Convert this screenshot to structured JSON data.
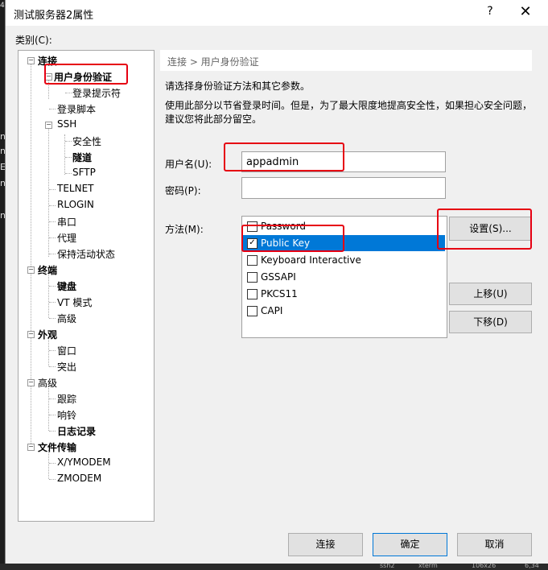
{
  "background_window": {
    "side_chars": [
      "n",
      "n",
      "E",
      "n",
      "n"
    ],
    "status_fragments": [
      "ssh2",
      "xterm",
      "106x26",
      "6,34"
    ]
  },
  "dialog": {
    "title": "测试服务器2属性",
    "help_label": "?",
    "close_label": "✕",
    "category_label": "类别(C):"
  },
  "tree": {
    "connection": "连接",
    "auth": "用户身份验证",
    "login_prompt": "登录提示符",
    "login_script": "登录脚本",
    "ssh": "SSH",
    "security": "安全性",
    "tunnel": "隧道",
    "sftp": "SFTP",
    "telnet": "TELNET",
    "rlogin": "RLOGIN",
    "serial": "串口",
    "proxy": "代理",
    "keepalive": "保持活动状态",
    "terminal": "终端",
    "keyboard": "键盘",
    "vt_mode": "VT 模式",
    "advanced_term": "高级",
    "appearance": "外观",
    "window": "窗口",
    "highlight": "突出",
    "advanced": "高级",
    "trace": "跟踪",
    "bell": "响铃",
    "logging": "日志记录",
    "file_transfer": "文件传输",
    "xymodem": "X/YMODEM",
    "zmodem": "ZMODEM"
  },
  "panel": {
    "breadcrumb": "连接 > 用户身份验证",
    "desc1": "请选择身份验证方法和其它参数。",
    "desc2": "使用此部分以节省登录时间。但是，为了最大限度地提高安全性，如果担心安全问题，",
    "desc3": "建议您将此部分留空。",
    "username_label": "用户名(U):",
    "username_value": "appadmin",
    "password_label": "密码(P):",
    "password_value": "",
    "method_label": "方法(M):",
    "methods": [
      {
        "label": "Password",
        "checked": false
      },
      {
        "label": "Public Key",
        "checked": true
      },
      {
        "label": "Keyboard Interactive",
        "checked": false
      },
      {
        "label": "GSSAPI",
        "checked": false
      },
      {
        "label": "PKCS11",
        "checked": false
      },
      {
        "label": "CAPI",
        "checked": false
      }
    ],
    "settings_button": "设置(S)...",
    "move_up_button": "上移(U)",
    "move_down_button": "下移(D)"
  },
  "footer": {
    "connect_button": "连接",
    "ok_button": "确定",
    "cancel_button": "取消"
  },
  "colors": {
    "selection": "#0078d7",
    "annotation": "#e60012"
  }
}
